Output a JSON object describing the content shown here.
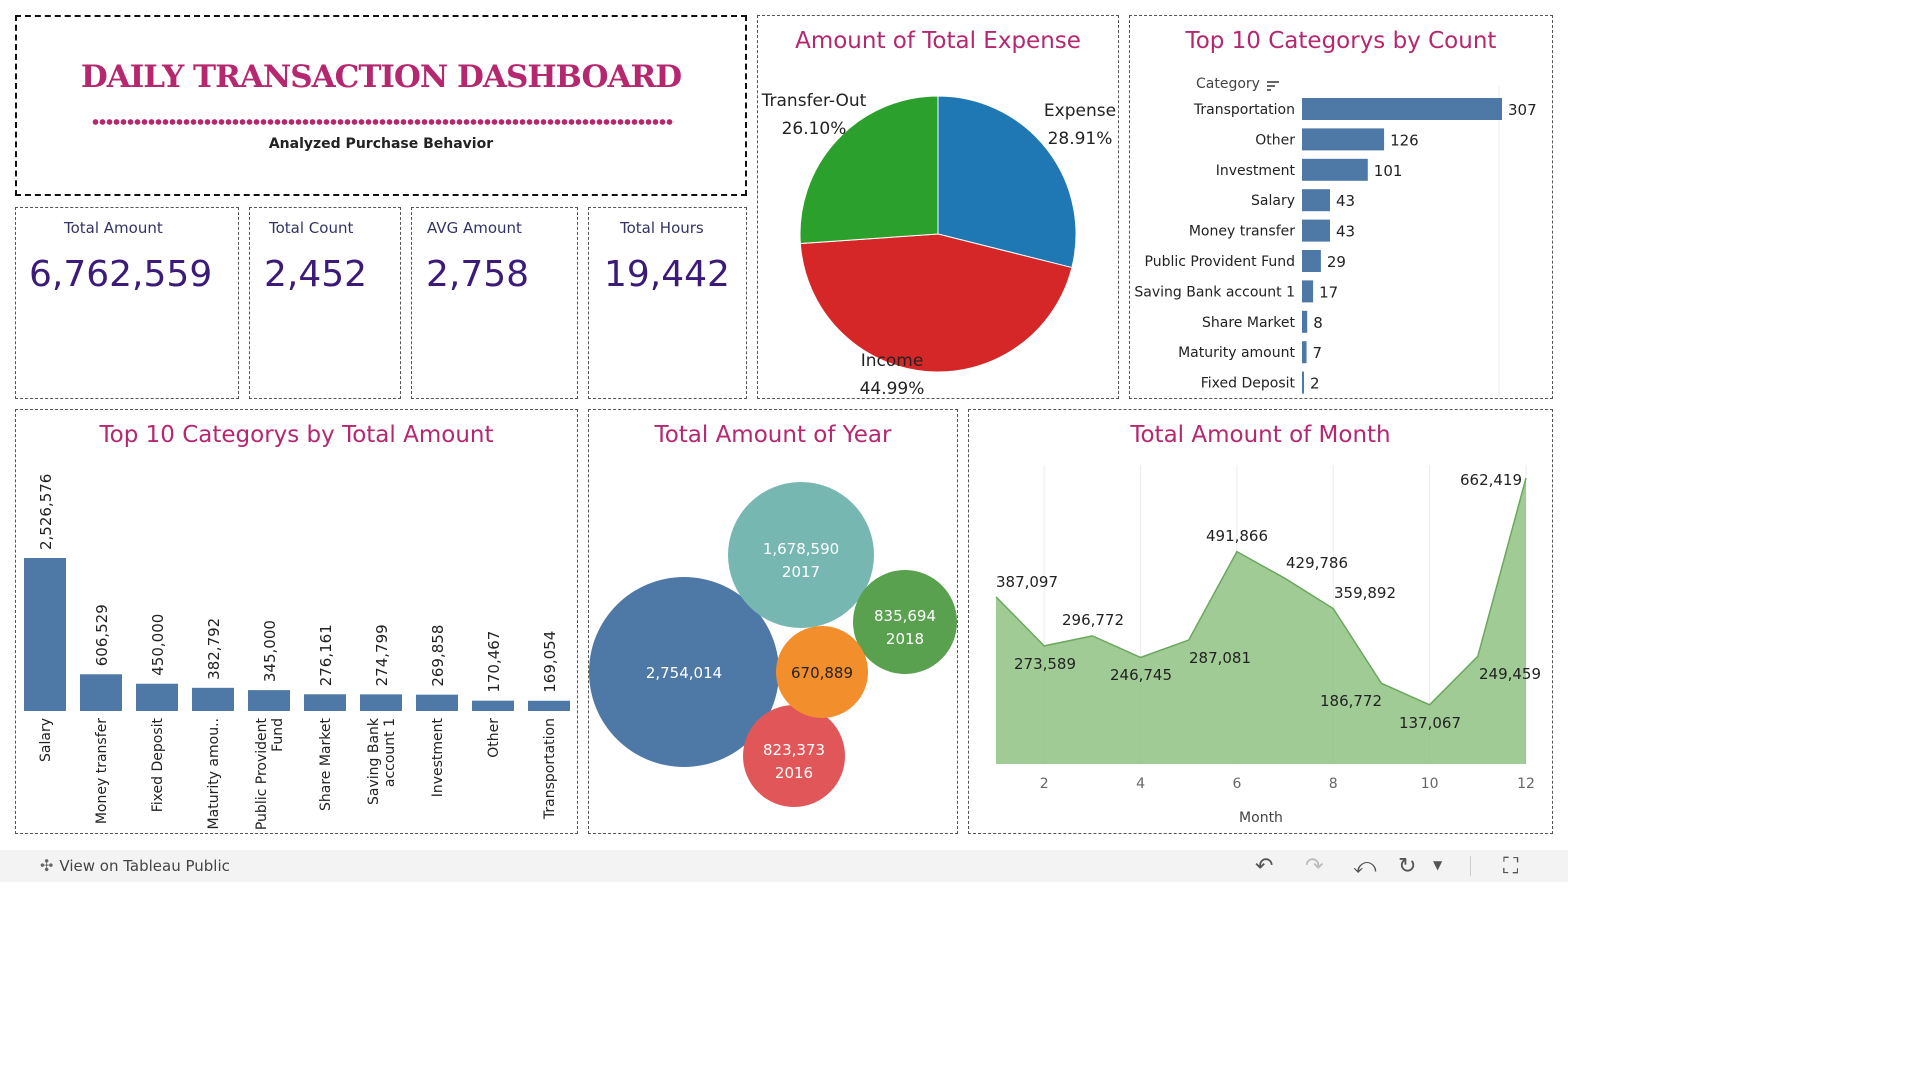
{
  "header": {
    "title": "DAILY TRANSACTION DASHBOARD",
    "subtitle": "Analyzed Purchase Behavior",
    "title_color": "#b5286f"
  },
  "kpis": [
    {
      "label": "Total Amount",
      "value": "6,762,559"
    },
    {
      "label": "Total Count",
      "value": "2,452"
    },
    {
      "label": "AVG Amount",
      "value": "2,758"
    },
    {
      "label": "Total Hours",
      "value": "19,442"
    }
  ],
  "panels": {
    "pie_title": "Amount of Total Expense",
    "count_title": "Top 10 Categorys by Count",
    "count_header": "Category",
    "amount_title": "Top 10 Categorys by Total Amount",
    "year_title": "Total Amount of Year",
    "month_title": "Total Amount of Month"
  },
  "chart_data": [
    {
      "type": "pie",
      "title": "Amount of Total Expense",
      "slices": [
        {
          "label": "Expense",
          "value": 28.91,
          "text": "28.91%",
          "color": "#1f77b4"
        },
        {
          "label": "Income",
          "value": 44.99,
          "text": "44.99%",
          "color": "#d62728"
        },
        {
          "label": "Transfer-Out",
          "value": 26.1,
          "text": "26.10%",
          "color": "#2ca02c"
        }
      ]
    },
    {
      "type": "bar",
      "orientation": "horizontal",
      "title": "Top 10 Categorys by Count",
      "categories": [
        "Transportation",
        "Other",
        "Investment",
        "Salary",
        "Money transfer",
        "Public Provident Fund",
        "Saving Bank account 1",
        "Share Market",
        "Maturity amount",
        "Fixed Deposit"
      ],
      "values": [
        307,
        126,
        101,
        43,
        43,
        29,
        17,
        8,
        7,
        2
      ],
      "color": "#4e79a7"
    },
    {
      "type": "bar",
      "title": "Top 10 Categorys by Total Amount",
      "categories": [
        "Salary",
        "Money transfer",
        "Fixed Deposit",
        "Maturity amou..",
        "Public Provident Fund",
        "Share Market",
        "Saving Bank account 1",
        "Investment",
        "Other",
        "Transportation"
      ],
      "values": [
        2526576,
        606529,
        450000,
        382792,
        345000,
        276161,
        274799,
        269858,
        170467,
        169054
      ],
      "value_labels": [
        "2,526,576",
        "606,529",
        "450,000",
        "382,792",
        "345,000",
        "276,161",
        "274,799",
        "269,858",
        "170,467",
        "169,054"
      ],
      "color": "#4e79a7"
    },
    {
      "type": "bubble",
      "title": "Total Amount of Year",
      "bubbles": [
        {
          "year": "",
          "value": 2754014,
          "label": "2,754,014",
          "color": "#4e79a7"
        },
        {
          "year": "2017",
          "value": 1678590,
          "label": "1,678,590",
          "color": "#76b7b2"
        },
        {
          "year": "2018",
          "value": 835694,
          "label": "835,694",
          "color": "#59a14f"
        },
        {
          "year": "2016",
          "value": 823373,
          "label": "823,373",
          "color": "#e15759"
        },
        {
          "year": "",
          "value": 670889,
          "label": "670,889",
          "color": "#f28e2b"
        }
      ]
    },
    {
      "type": "area",
      "title": "Total Amount of Month",
      "xlabel": "Month",
      "x": [
        1,
        2,
        3,
        4,
        5,
        6,
        7,
        8,
        9,
        10,
        11,
        12
      ],
      "values": [
        387097,
        273589,
        296772,
        246745,
        287081,
        491866,
        429786,
        359892,
        186772,
        137067,
        249459,
        662419
      ],
      "value_labels": [
        "387,097",
        "273,589",
        "296,772",
        "246,745",
        "287,081",
        "491,866",
        "429,786",
        "359,892",
        "186,772",
        "137,067",
        "249,459",
        "662,419"
      ],
      "xticks": [
        2,
        4,
        6,
        8,
        10,
        12
      ],
      "xlim": [
        1,
        12
      ],
      "color": "#8fc283"
    }
  ],
  "footer": {
    "link_label": "View on Tableau Public"
  }
}
